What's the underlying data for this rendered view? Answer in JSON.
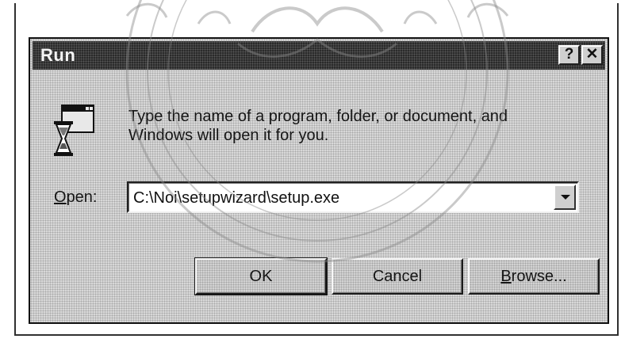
{
  "window": {
    "title": "Run",
    "help_label": "?",
    "close_label": "✕"
  },
  "prompt": {
    "line1": "Type the name of a program, folder, or document, and",
    "line2": "Windows will open it for you."
  },
  "open_field": {
    "label_accel": "O",
    "label_rest": "pen:",
    "value": "C:\\Noi\\setupwizard\\setup.exe"
  },
  "buttons": {
    "ok": "OK",
    "cancel": "Cancel",
    "browse_accel": "B",
    "browse_rest": "rowse..."
  },
  "icons": {
    "dialog_icon": "run-program-icon",
    "dropdown": "chevron-down-icon"
  },
  "colors": {
    "titlebar": "#2a2a2a",
    "dialog_face": "#d8d8d8",
    "text": "#151515"
  }
}
